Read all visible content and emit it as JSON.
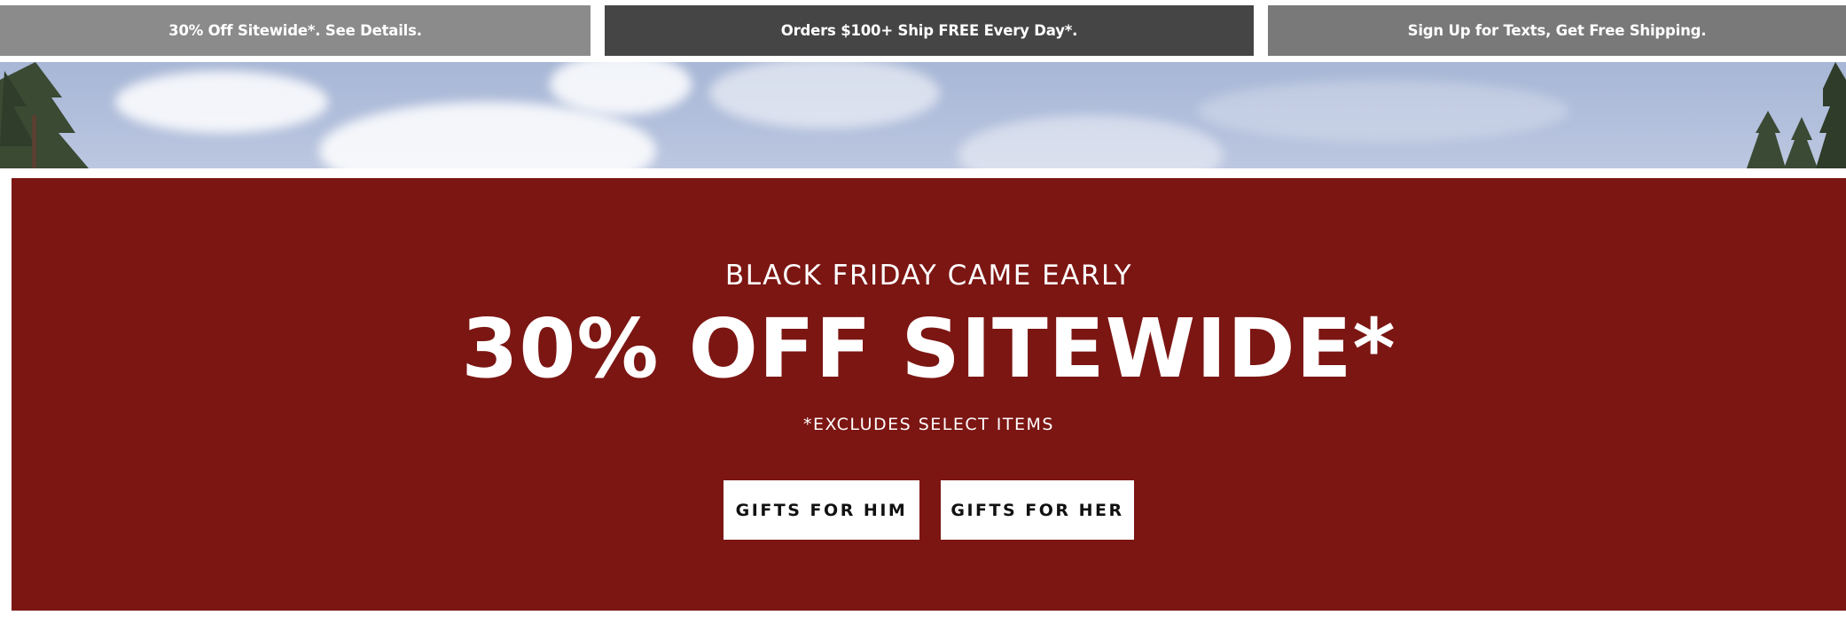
{
  "promo_bar": {
    "tiles": [
      {
        "label": "30% Off Sitewide*. See Details.",
        "color": "#8b8b8b"
      },
      {
        "label": "Orders $100+ Ship FREE Every Day*.",
        "color": "#454545"
      },
      {
        "label": "Sign Up for Texts, Get Free Shipping.",
        "color": "#797979"
      }
    ]
  },
  "hero": {
    "background_color": "#7c1613",
    "eyebrow": "BLACK FRIDAY CAME EARLY",
    "headline": "30% OFF SITEWIDE*",
    "disclaimer": "*EXCLUDES SELECT ITEMS",
    "buttons": [
      {
        "label": "GIFTS FOR HIM"
      },
      {
        "label": "GIFTS FOR HER"
      }
    ]
  }
}
